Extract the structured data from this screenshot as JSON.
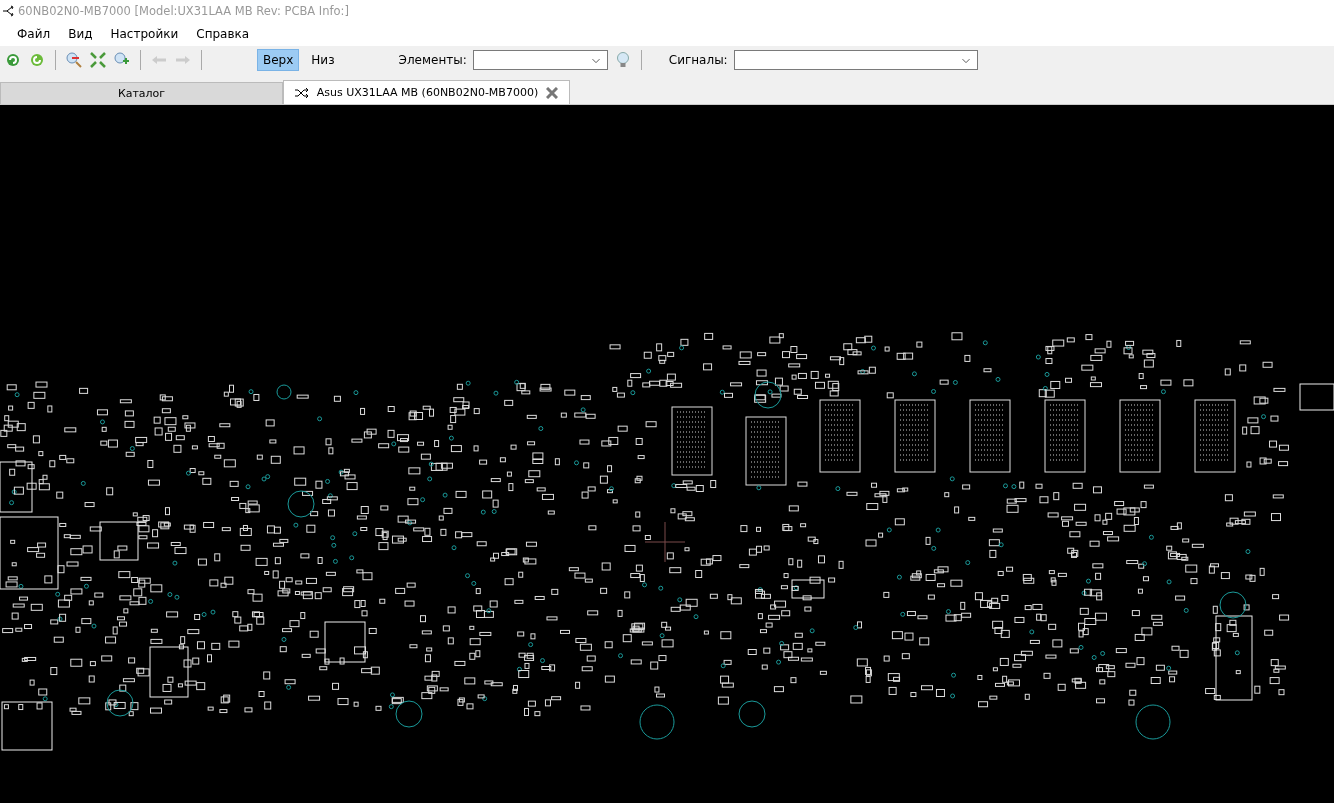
{
  "window": {
    "title": "60NB02N0-MB7000 [Model:UX31LAA MB Rev: PCBA Info:]"
  },
  "menu": [
    "Файл",
    "Вид",
    "Настройки",
    "Справка"
  ],
  "toolbar": {
    "layers": [
      {
        "label": "Верх",
        "selected": true
      },
      {
        "label": "Низ",
        "selected": false
      }
    ],
    "elements_label": "Элементы:",
    "signals_label": "Сигналы:"
  },
  "tabs": [
    {
      "label": "Каталог",
      "selected": false,
      "closable": false
    },
    {
      "label": "Asus UX31LAA MB (60NB02N0-MB7000)",
      "selected": true,
      "closable": true
    }
  ]
}
